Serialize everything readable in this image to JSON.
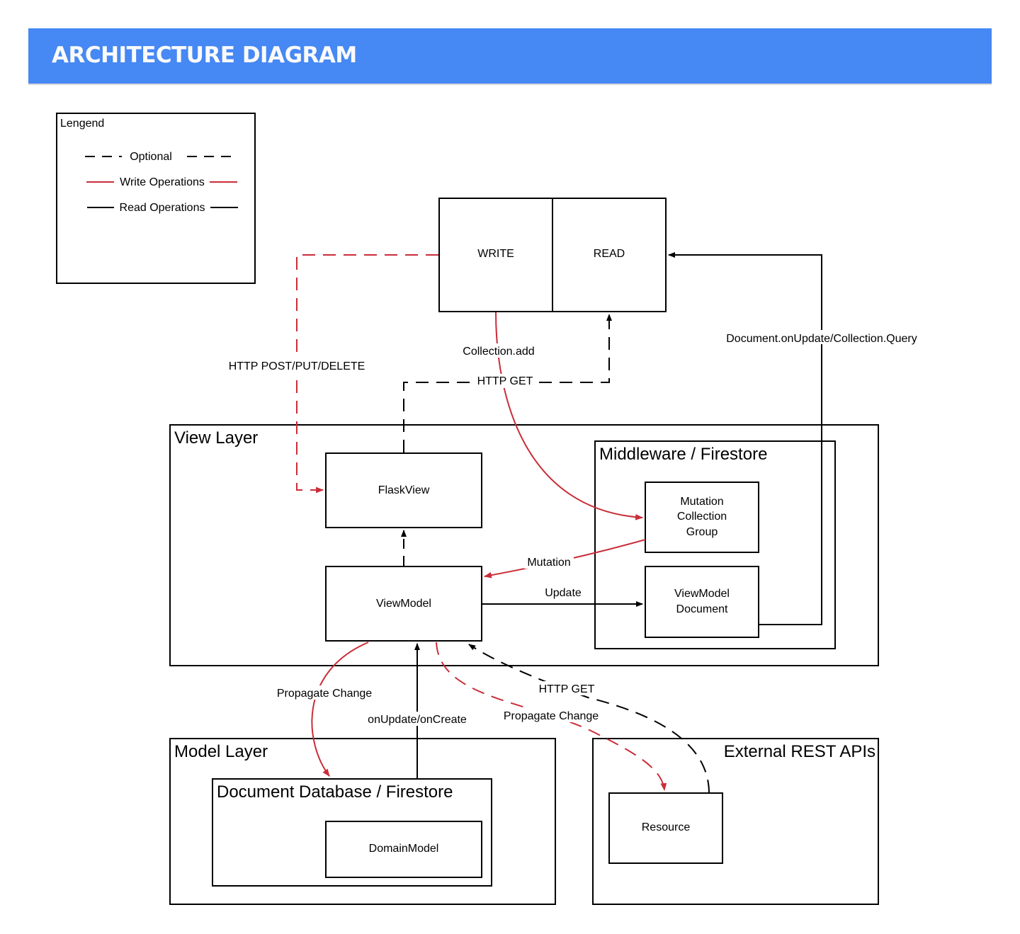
{
  "header": {
    "title": "ARCHITECTURE DIAGRAM",
    "background_color": "#4688f4",
    "title_color": "#fafafa"
  },
  "colors": {
    "write": "#c92d39",
    "read": "#000000"
  },
  "legend": {
    "title": "Lengend",
    "items": [
      {
        "label": "Optional",
        "style": "dashed",
        "color": "#000000"
      },
      {
        "label": "Write Operations",
        "style": "solid",
        "color": "#c92d39"
      },
      {
        "label": "Read Operations",
        "style": "solid",
        "color": "#000000"
      }
    ]
  },
  "api_box": {
    "write_label": "WRITE",
    "read_label": "READ"
  },
  "containers": {
    "view_layer": "View Layer",
    "middleware": "Middleware / Firestore",
    "model_layer": "Model Layer",
    "document_db": "Document Database / Firestore",
    "external_apis": "External REST APIs"
  },
  "nodes": {
    "flaskview": "FlaskView",
    "viewmodel": "ViewModel",
    "mutation_group": [
      "Mutation",
      "Collection",
      "Group"
    ],
    "viewmodel_document": [
      "ViewModel",
      "Document"
    ],
    "domain_model": "DomainModel",
    "resource": "Resource"
  },
  "edges": [
    {
      "from": "WRITE",
      "to": "FlaskView",
      "label": "HTTP POST/PUT/DELETE",
      "type": "write",
      "optional": true
    },
    {
      "from": "WRITE",
      "to": "Mutation Collection Group",
      "label": "Collection.add",
      "type": "write",
      "optional": false
    },
    {
      "from": "FlaskView",
      "to": "READ",
      "label": "HTTP GET",
      "type": "read",
      "optional": true
    },
    {
      "from": "ViewModel Document",
      "to": "READ",
      "label": "Document.onUpdate/Collection.Query",
      "type": "read",
      "optional": false
    },
    {
      "from": "ViewModel",
      "to": "FlaskView",
      "label": "",
      "type": "read",
      "optional": true
    },
    {
      "from": "Mutation Collection Group",
      "to": "ViewModel",
      "label": "Mutation",
      "type": "write",
      "optional": false
    },
    {
      "from": "ViewModel",
      "to": "ViewModel Document",
      "label": "Update",
      "type": "read",
      "optional": false
    },
    {
      "from": "ViewModel",
      "to": "Document Database / Firestore",
      "label": "Propagate Change",
      "type": "write",
      "optional": false
    },
    {
      "from": "Document Database / Firestore",
      "to": "ViewModel",
      "label": "onUpdate/onCreate",
      "type": "read",
      "optional": false
    },
    {
      "from": "ViewModel",
      "to": "Resource",
      "label": "Propagate Change",
      "type": "write",
      "optional": true
    },
    {
      "from": "Resource",
      "to": "ViewModel",
      "label": "HTTP GET",
      "type": "read",
      "optional": true
    }
  ]
}
